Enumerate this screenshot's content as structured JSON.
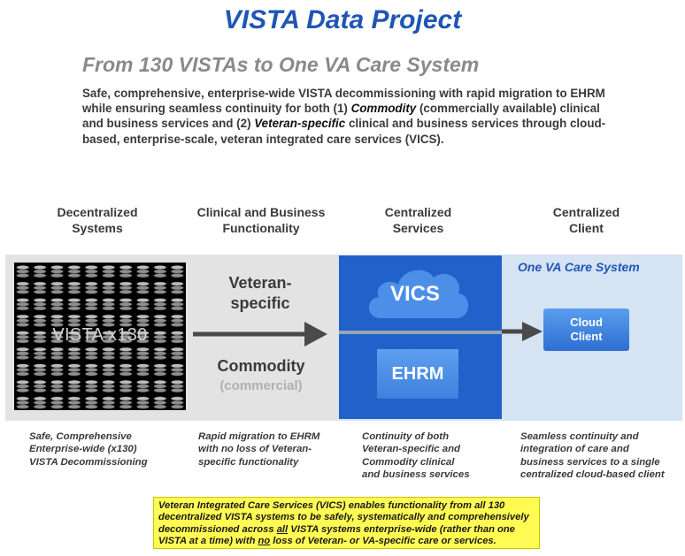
{
  "title": "VISTA Data Project",
  "subtitle": "From 130 VISTAs to One VA Care System",
  "intro": {
    "part1": "Safe, comprehensive, enterprise-wide VISTA decommissioning with rapid migration to EHRM while ensuring seamless continuity for both (1) ",
    "commodity": "Commodity",
    "part2": " (commercially available) clinical and business services and (2) ",
    "veteran_specific": "Veteran-specific",
    "part3": " clinical and business services through cloud-based, enterprise-scale, veteran integrated care services (VICS)."
  },
  "columns": [
    {
      "heading_line1": "Decentralized",
      "heading_line2": "Systems"
    },
    {
      "heading_line1": "Clinical and Business",
      "heading_line2": "Functionality"
    },
    {
      "heading_line1": "Centralized",
      "heading_line2": "Services"
    },
    {
      "heading_line1": "Centralized",
      "heading_line2": "Client"
    }
  ],
  "vista_label": "VISTA x130",
  "veteran_label_line1": "Veteran-",
  "veteran_label_line2": "specific",
  "commodity_label": "Commodity",
  "commodity_sub": "(commercial)",
  "vics_label": "VICS",
  "ehrm_label": "EHRM",
  "one_va_label": "One VA Care System",
  "cloud_client_line1": "Cloud",
  "cloud_client_line2": "Client",
  "descriptions": [
    {
      "l1": "Safe, Comprehensive",
      "l2": "Enterprise-wide (x130)",
      "l3": "VISTA Decommissioning"
    },
    {
      "l1": "Rapid migration to EHRM",
      "l2": "with no loss of Veteran-",
      "l3": "specific functionality"
    },
    {
      "l1": "Continuity of  both",
      "l2": "Veteran-specific and",
      "l3": "Commodity clinical",
      "l4": "and business services"
    },
    {
      "l1": "Seamless continuity  and",
      "l2": "integration of care and",
      "l3": "business services to a single",
      "l4": "centralized cloud-based client"
    }
  ],
  "note": {
    "p1": "Veteran Integrated Care Services (VICS)  enables functionality from all 130 decentralized VISTA  systems to be  safely, systematically and comprehensively decommissioned across ",
    "all": "all",
    "p2": " VISTA systems  enterprise-wide (rather than one VISTA at a time) with ",
    "no": "no",
    "p3": " loss of Veteran- or VA-specific care or services."
  },
  "colors": {
    "title": "#1f56b5",
    "services_box": "#2062c9",
    "ehrm_box": "#4a8ce6",
    "note_background": "#fffb53",
    "right_band": "#d6e3f3",
    "left_band": "#e3e3e3"
  },
  "icons": [
    "database-stack-icon",
    "cloud-icon",
    "arrow-right-icon"
  ]
}
